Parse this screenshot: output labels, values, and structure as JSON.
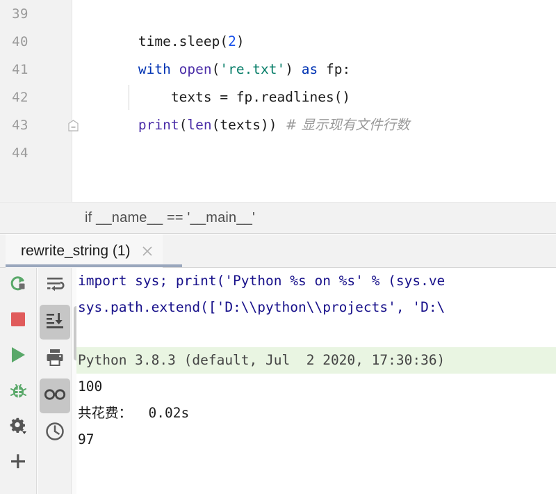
{
  "editor": {
    "line_numbers": [
      "39",
      "40",
      "41",
      "42",
      "43",
      "44"
    ],
    "fold_marker_icon": "fold-collapse-icon",
    "lines": [
      {
        "n": "39",
        "tokens": []
      },
      {
        "n": "40",
        "tokens": [
          {
            "t": "plain",
            "v": "        time.sleep("
          },
          {
            "t": "num",
            "v": "2"
          },
          {
            "t": "plain",
            "v": ")"
          }
        ]
      },
      {
        "n": "41",
        "tokens": [
          {
            "t": "kw",
            "v": "        with "
          },
          {
            "t": "bfn",
            "v": "open"
          },
          {
            "t": "plain",
            "v": "("
          },
          {
            "t": "str",
            "v": "'re.txt'"
          },
          {
            "t": "plain",
            "v": ") "
          },
          {
            "t": "kw",
            "v": "as"
          },
          {
            "t": "plain",
            "v": " fp:"
          }
        ]
      },
      {
        "n": "42",
        "tokens": [
          {
            "t": "plain",
            "v": "            texts = fp.readlines()"
          }
        ]
      },
      {
        "n": "43",
        "tokens": [
          {
            "t": "bfn",
            "v": "        print"
          },
          {
            "t": "plain",
            "v": "("
          },
          {
            "t": "bfn",
            "v": "len"
          },
          {
            "t": "plain",
            "v": "(texts))"
          },
          {
            "t": "cmt",
            "v": "  # 显示现有文件行数"
          }
        ]
      },
      {
        "n": "44",
        "tokens": []
      }
    ]
  },
  "breadcrumb": {
    "text": "if __name__ == '__main__'"
  },
  "tab": {
    "label": "rewrite_string (1)",
    "close_icon": "close-icon"
  },
  "console_toolbar": {
    "left_column": [
      {
        "name": "rerun-button",
        "icon": "rerun-icon",
        "selected": false
      },
      {
        "name": "stop-button",
        "icon": "stop-icon",
        "selected": false
      },
      {
        "name": "run-button",
        "icon": "run-icon",
        "selected": false
      },
      {
        "name": "debug-button",
        "icon": "bug-icon",
        "selected": false
      },
      {
        "name": "settings-button",
        "icon": "gear-icon",
        "selected": false
      },
      {
        "name": "add-button",
        "icon": "plus-icon",
        "selected": false
      }
    ],
    "second_column": [
      {
        "name": "soft-wrap-button",
        "icon": "soft-wrap-icon",
        "selected": false
      },
      {
        "name": "scroll-to-end-button",
        "icon": "scroll-to-end-icon",
        "selected": true
      },
      {
        "name": "print-button",
        "icon": "print-icon",
        "selected": false
      },
      {
        "name": "toggle-view-button",
        "icon": "glasses-icon",
        "selected": true
      },
      {
        "name": "history-button",
        "icon": "clock-icon",
        "selected": false
      }
    ]
  },
  "console": {
    "lines": [
      {
        "kind": "cmd",
        "text": "import sys; print('Python %s on %s' % (sys.ve"
      },
      {
        "kind": "cmd",
        "text": "sys.path.extend(['D:\\\\python\\\\projects', 'D:\\"
      },
      {
        "kind": "blank",
        "text": " "
      },
      {
        "kind": "sysinfo",
        "text": "Python 3.8.3 (default, Jul  2 2020, 17:30:36)"
      },
      {
        "kind": "out",
        "text": "100"
      },
      {
        "kind": "out",
        "text": "共花费：  0.02s"
      },
      {
        "kind": "out",
        "text": "97"
      }
    ]
  },
  "colors": {
    "keyword": "#0033b3",
    "builtin": "#4b2ea8",
    "string": "#067d68",
    "number": "#1750eb",
    "comment": "#9a9a9a",
    "console_command": "#17108a",
    "sysinfo_bg": "#e9f5e2",
    "run_green": "#59a869",
    "stop_red": "#e05b5b",
    "tab_underline": "#9aa7bd",
    "panel_bg": "#f2f2f2"
  }
}
